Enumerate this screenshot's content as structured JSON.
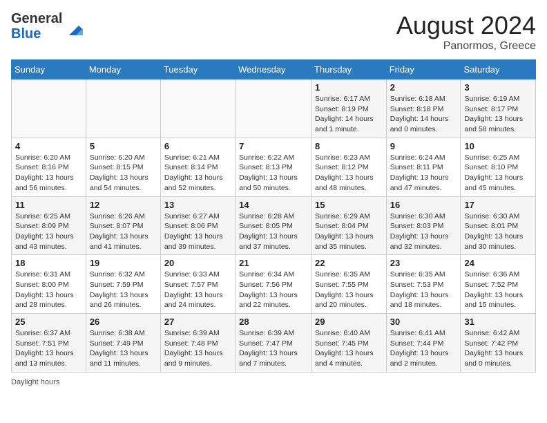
{
  "header": {
    "logo_general": "General",
    "logo_blue": "Blue",
    "month_year": "August 2024",
    "location": "Panormos, Greece"
  },
  "calendar": {
    "days_of_week": [
      "Sunday",
      "Monday",
      "Tuesday",
      "Wednesday",
      "Thursday",
      "Friday",
      "Saturday"
    ],
    "weeks": [
      [
        {
          "day": "",
          "info": ""
        },
        {
          "day": "",
          "info": ""
        },
        {
          "day": "",
          "info": ""
        },
        {
          "day": "",
          "info": ""
        },
        {
          "day": "1",
          "info": "Sunrise: 6:17 AM\nSunset: 8:19 PM\nDaylight: 14 hours\nand 1 minute."
        },
        {
          "day": "2",
          "info": "Sunrise: 6:18 AM\nSunset: 8:18 PM\nDaylight: 14 hours\nand 0 minutes."
        },
        {
          "day": "3",
          "info": "Sunrise: 6:19 AM\nSunset: 8:17 PM\nDaylight: 13 hours\nand 58 minutes."
        }
      ],
      [
        {
          "day": "4",
          "info": "Sunrise: 6:20 AM\nSunset: 8:16 PM\nDaylight: 13 hours\nand 56 minutes."
        },
        {
          "day": "5",
          "info": "Sunrise: 6:20 AM\nSunset: 8:15 PM\nDaylight: 13 hours\nand 54 minutes."
        },
        {
          "day": "6",
          "info": "Sunrise: 6:21 AM\nSunset: 8:14 PM\nDaylight: 13 hours\nand 52 minutes."
        },
        {
          "day": "7",
          "info": "Sunrise: 6:22 AM\nSunset: 8:13 PM\nDaylight: 13 hours\nand 50 minutes."
        },
        {
          "day": "8",
          "info": "Sunrise: 6:23 AM\nSunset: 8:12 PM\nDaylight: 13 hours\nand 48 minutes."
        },
        {
          "day": "9",
          "info": "Sunrise: 6:24 AM\nSunset: 8:11 PM\nDaylight: 13 hours\nand 47 minutes."
        },
        {
          "day": "10",
          "info": "Sunrise: 6:25 AM\nSunset: 8:10 PM\nDaylight: 13 hours\nand 45 minutes."
        }
      ],
      [
        {
          "day": "11",
          "info": "Sunrise: 6:25 AM\nSunset: 8:09 PM\nDaylight: 13 hours\nand 43 minutes."
        },
        {
          "day": "12",
          "info": "Sunrise: 6:26 AM\nSunset: 8:07 PM\nDaylight: 13 hours\nand 41 minutes."
        },
        {
          "day": "13",
          "info": "Sunrise: 6:27 AM\nSunset: 8:06 PM\nDaylight: 13 hours\nand 39 minutes."
        },
        {
          "day": "14",
          "info": "Sunrise: 6:28 AM\nSunset: 8:05 PM\nDaylight: 13 hours\nand 37 minutes."
        },
        {
          "day": "15",
          "info": "Sunrise: 6:29 AM\nSunset: 8:04 PM\nDaylight: 13 hours\nand 35 minutes."
        },
        {
          "day": "16",
          "info": "Sunrise: 6:30 AM\nSunset: 8:03 PM\nDaylight: 13 hours\nand 32 minutes."
        },
        {
          "day": "17",
          "info": "Sunrise: 6:30 AM\nSunset: 8:01 PM\nDaylight: 13 hours\nand 30 minutes."
        }
      ],
      [
        {
          "day": "18",
          "info": "Sunrise: 6:31 AM\nSunset: 8:00 PM\nDaylight: 13 hours\nand 28 minutes."
        },
        {
          "day": "19",
          "info": "Sunrise: 6:32 AM\nSunset: 7:59 PM\nDaylight: 13 hours\nand 26 minutes."
        },
        {
          "day": "20",
          "info": "Sunrise: 6:33 AM\nSunset: 7:57 PM\nDaylight: 13 hours\nand 24 minutes."
        },
        {
          "day": "21",
          "info": "Sunrise: 6:34 AM\nSunset: 7:56 PM\nDaylight: 13 hours\nand 22 minutes."
        },
        {
          "day": "22",
          "info": "Sunrise: 6:35 AM\nSunset: 7:55 PM\nDaylight: 13 hours\nand 20 minutes."
        },
        {
          "day": "23",
          "info": "Sunrise: 6:35 AM\nSunset: 7:53 PM\nDaylight: 13 hours\nand 18 minutes."
        },
        {
          "day": "24",
          "info": "Sunrise: 6:36 AM\nSunset: 7:52 PM\nDaylight: 13 hours\nand 15 minutes."
        }
      ],
      [
        {
          "day": "25",
          "info": "Sunrise: 6:37 AM\nSunset: 7:51 PM\nDaylight: 13 hours\nand 13 minutes."
        },
        {
          "day": "26",
          "info": "Sunrise: 6:38 AM\nSunset: 7:49 PM\nDaylight: 13 hours\nand 11 minutes."
        },
        {
          "day": "27",
          "info": "Sunrise: 6:39 AM\nSunset: 7:48 PM\nDaylight: 13 hours\nand 9 minutes."
        },
        {
          "day": "28",
          "info": "Sunrise: 6:39 AM\nSunset: 7:47 PM\nDaylight: 13 hours\nand 7 minutes."
        },
        {
          "day": "29",
          "info": "Sunrise: 6:40 AM\nSunset: 7:45 PM\nDaylight: 13 hours\nand 4 minutes."
        },
        {
          "day": "30",
          "info": "Sunrise: 6:41 AM\nSunset: 7:44 PM\nDaylight: 13 hours\nand 2 minutes."
        },
        {
          "day": "31",
          "info": "Sunrise: 6:42 AM\nSunset: 7:42 PM\nDaylight: 13 hours\nand 0 minutes."
        }
      ]
    ]
  },
  "footer": {
    "daylight_label": "Daylight hours"
  }
}
